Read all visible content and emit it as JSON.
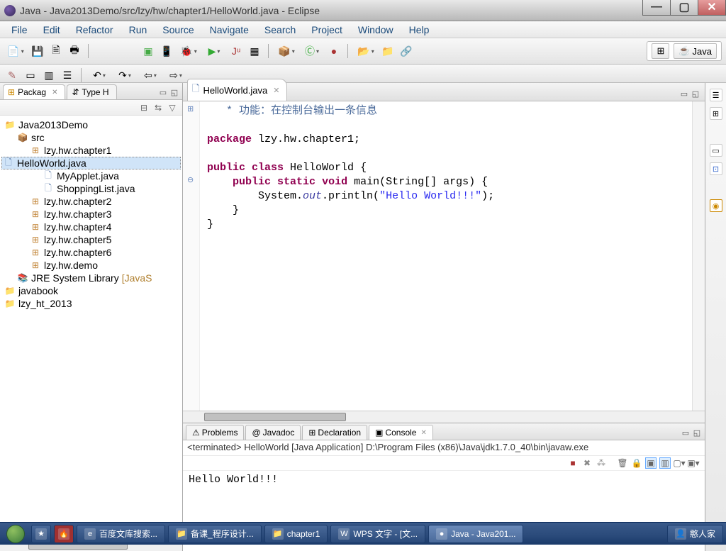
{
  "window": {
    "title": "Java - Java2013Demo/src/lzy/hw/chapter1/HelloWorld.java - Eclipse"
  },
  "menus": [
    "File",
    "Edit",
    "Refactor",
    "Run",
    "Source",
    "Navigate",
    "Search",
    "Project",
    "Window",
    "Help"
  ],
  "perspective": {
    "label": "Java"
  },
  "package_explorer": {
    "tab1": "Packag",
    "tab2": "Type H",
    "tree": [
      {
        "level": 0,
        "icon": "proj",
        "label": "Java2013Demo"
      },
      {
        "level": 1,
        "icon": "src",
        "label": "src"
      },
      {
        "level": 2,
        "icon": "pkg",
        "label": "lzy.hw.chapter1"
      },
      {
        "level": 3,
        "icon": "java",
        "label": "HelloWorld.java",
        "selected": true
      },
      {
        "level": 3,
        "icon": "java",
        "label": "MyApplet.java"
      },
      {
        "level": 3,
        "icon": "java",
        "label": "ShoppingList.java"
      },
      {
        "level": 2,
        "icon": "pkg",
        "label": "lzy.hw.chapter2"
      },
      {
        "level": 2,
        "icon": "pkg",
        "label": "lzy.hw.chapter3"
      },
      {
        "level": 2,
        "icon": "pkg",
        "label": "lzy.hw.chapter4"
      },
      {
        "level": 2,
        "icon": "pkg",
        "label": "lzy.hw.chapter5"
      },
      {
        "level": 2,
        "icon": "pkg",
        "label": "lzy.hw.chapter6"
      },
      {
        "level": 2,
        "icon": "pkg",
        "label": "lzy.hw.demo"
      },
      {
        "level": 1,
        "icon": "lib",
        "label": "JRE System Library",
        "suffix": " [JavaS"
      },
      {
        "level": 0,
        "icon": "proj",
        "label": "javabook"
      },
      {
        "level": 0,
        "icon": "proj",
        "label": "lzy_ht_2013"
      }
    ]
  },
  "editor": {
    "tab": "HelloWorld.java",
    "code_html": "   <span class=\"cmt\">* 功能：在控制台输出一条信息</span>\n\n<span class=\"kw\">package</span> lzy.hw.chapter1;\n\n<span class=\"kw\">public</span> <span class=\"kw\">class</span> HelloWorld {\n    <span class=\"kw\">public</span> <span class=\"kw\">static</span> <span class=\"kw\">void</span> main(String[] args) {\n        System.<span class=\"it\">out</span>.println(<span class=\"str\">\"Hello World!!!\"</span>);\n    }\n}"
  },
  "bottom": {
    "tabs": [
      "Problems",
      "Javadoc",
      "Declaration",
      "Console"
    ],
    "active": "Console",
    "console_header": "<terminated> HelloWorld [Java Application] D:\\Program Files (x86)\\Java\\jdk1.7.0_40\\bin\\javaw.exe",
    "console_output": "Hello World!!!"
  },
  "taskbar": {
    "items": [
      {
        "icon": "🔥",
        "label": ""
      },
      {
        "icon": "e",
        "label": "百度文库搜索..."
      },
      {
        "icon": "📁",
        "label": "备课_程序设计..."
      },
      {
        "icon": "📁",
        "label": "chapter1"
      },
      {
        "icon": "W",
        "label": "WPS 文字 - [文..."
      },
      {
        "icon": "●",
        "label": "Java - Java201..."
      },
      {
        "icon": "👤",
        "label": "憨人家"
      }
    ]
  }
}
